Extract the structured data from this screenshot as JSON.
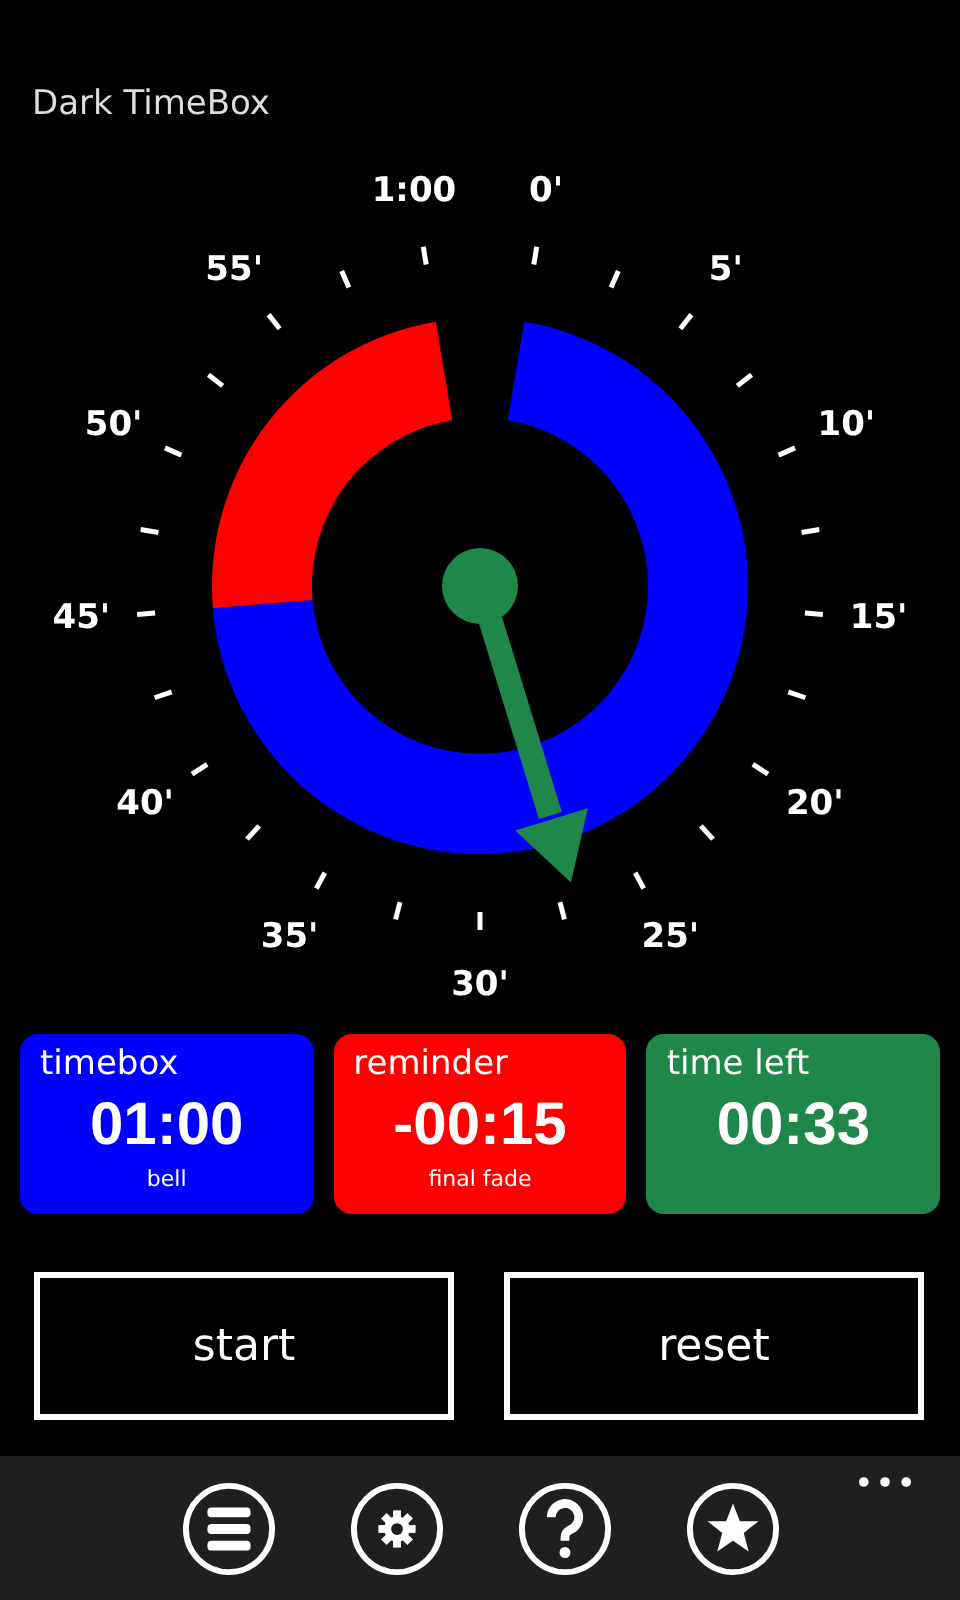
{
  "app_title": "Dark TimeBox",
  "dial": {
    "labels": [
      "0'",
      "5'",
      "10'",
      "15'",
      "20'",
      "25'",
      "30'",
      "35'",
      "40'",
      "45'",
      "50'",
      "55'",
      "1:00"
    ]
  },
  "cards": [
    {
      "title": "timebox",
      "value": "01:00",
      "caption": "bell",
      "color": "#0000ff"
    },
    {
      "title": "reminder",
      "value": "-00:15",
      "caption": "final fade",
      "color": "#ff0000"
    },
    {
      "title": "time left",
      "value": "00:33",
      "color": "#20874a"
    }
  ],
  "buttons": [
    "start",
    "reset"
  ],
  "app_bar": {
    "icons": [
      {
        "kind": "menu"
      },
      {
        "kind": "settings"
      },
      {
        "kind": "help"
      },
      {
        "kind": "favorite"
      }
    ]
  }
}
